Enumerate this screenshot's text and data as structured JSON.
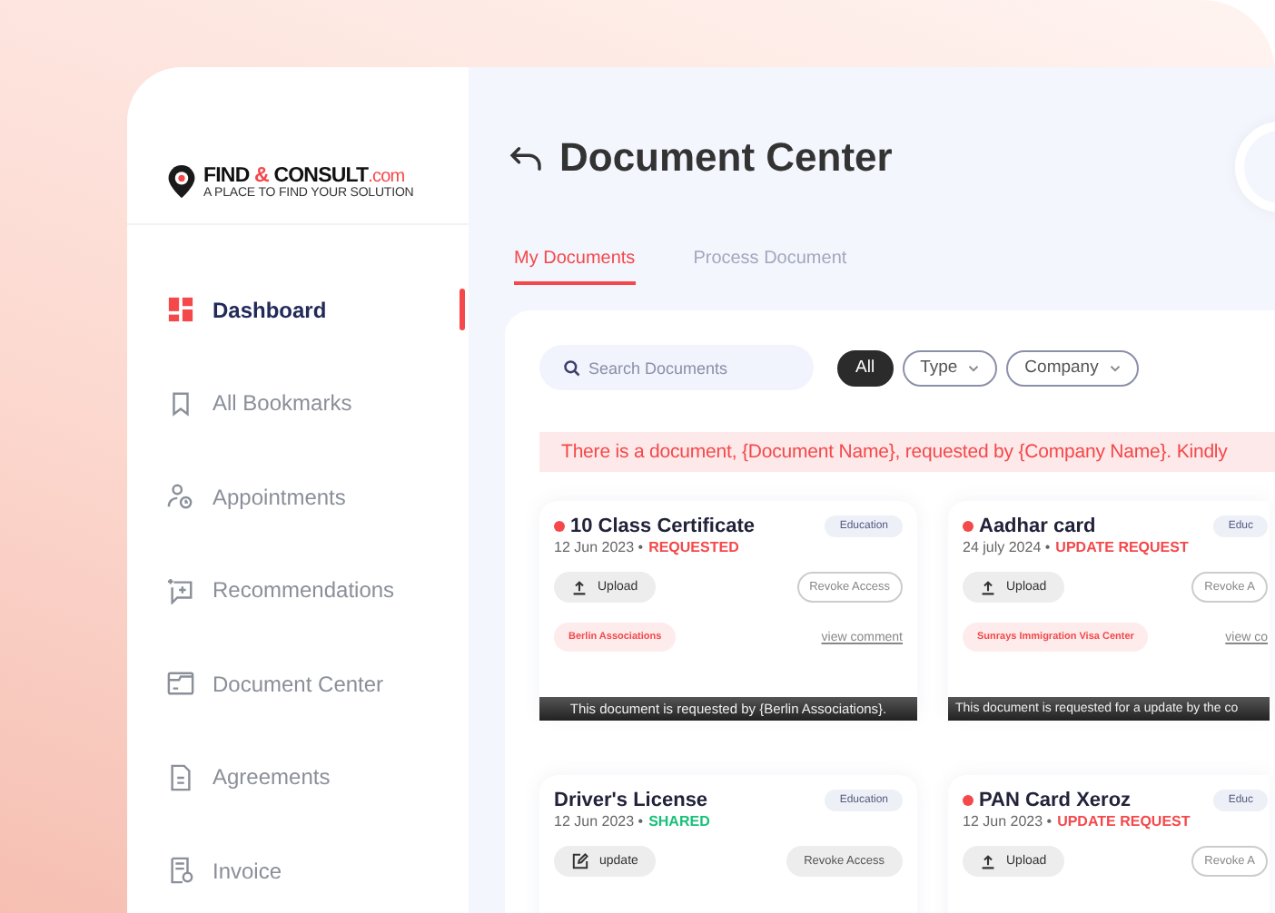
{
  "logo": {
    "brand": "FIND",
    "amp": "&",
    "brand2": "CONSULT",
    "domain": ".com",
    "tagline": "A PLACE TO FIND YOUR SOLUTION"
  },
  "sidebar": {
    "items": [
      {
        "label": "Dashboard",
        "kind": "grid",
        "selected": true
      },
      {
        "label": "All Bookmarks",
        "kind": "bookmark",
        "selected": false
      },
      {
        "label": "Appointments",
        "kind": "person",
        "selected": false
      },
      {
        "label": "Recommendations",
        "kind": "chat",
        "selected": false
      },
      {
        "label": "Document Center",
        "kind": "folder",
        "selected": false
      },
      {
        "label": "Agreements",
        "kind": "file",
        "selected": false
      },
      {
        "label": "Invoice",
        "kind": "receipt",
        "selected": false
      }
    ]
  },
  "header": {
    "title": "Document Center"
  },
  "tabs": [
    {
      "label": "My Documents",
      "selected": true
    },
    {
      "label": "Process Document",
      "selected": false
    }
  ],
  "search": {
    "placeholder": "Search Documents"
  },
  "filters": [
    {
      "label": "All",
      "selected": true,
      "dropdown": false
    },
    {
      "label": "Type",
      "selected": false,
      "dropdown": true
    },
    {
      "label": "Company",
      "selected": false,
      "dropdown": true
    }
  ],
  "notice": "There is a document, {Document Name}, requested by {Company Name}. Kindly",
  "documents": [
    {
      "name": "10 Class Certificate",
      "alert": true,
      "category": "Education",
      "date": "12 Jun 2023 •",
      "status": {
        "text": "REQUESTED",
        "kind": "alert"
      },
      "action": {
        "label": "Upload",
        "kind": "upload"
      },
      "revoke": {
        "label": "Revoke Access",
        "kind": "outline"
      },
      "company": "Berlin Associations",
      "link": "view comment",
      "footer": "This document is requested by {Berlin Associations}."
    },
    {
      "name": "Aadhar card",
      "alert": true,
      "category": "Educ",
      "date": "24 july 2024 •",
      "status": {
        "text": "UPDATE REQUEST",
        "kind": "alert"
      },
      "action": {
        "label": "Upload",
        "kind": "upload"
      },
      "revoke": {
        "label": "Revoke A",
        "kind": "outline"
      },
      "company": "Sunrays Immigration Visa Center",
      "link": "view co",
      "footer": "This document is requested for a update by the co"
    },
    {
      "name": "Driver's License",
      "alert": false,
      "category": "Education",
      "date": "12 Jun 2023 •",
      "status": {
        "text": "SHARED",
        "kind": "ok"
      },
      "action": {
        "label": "update",
        "kind": "edit"
      },
      "revoke": {
        "label": "Revoke Access",
        "kind": "filled"
      }
    },
    {
      "name": "PAN Card Xeroz",
      "alert": true,
      "category": "Educ",
      "date": "12 Jun 2023 •",
      "status": {
        "text": "UPDATE REQUEST",
        "kind": "alert"
      },
      "action": {
        "label": "Upload",
        "kind": "upload"
      },
      "revoke": {
        "label": "Revoke A",
        "kind": "outline"
      }
    }
  ]
}
